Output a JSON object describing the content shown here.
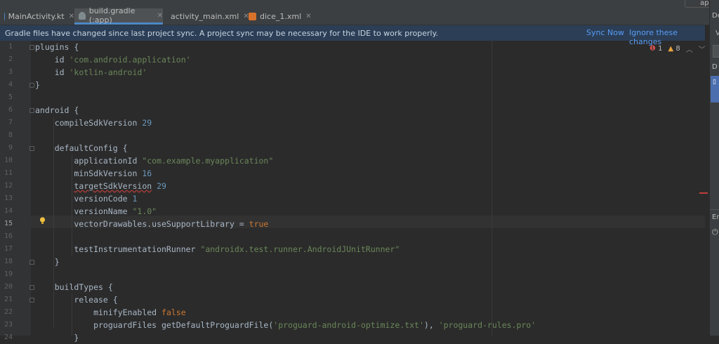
{
  "tabs": [
    {
      "label": "MainActivity.kt",
      "icon": "kotlin-file-icon",
      "active": false
    },
    {
      "label": "build.gradle (:app)",
      "icon": "gradle-elephant-icon",
      "active": true
    },
    {
      "label": "activity_main.xml",
      "icon": "layout-xml-icon",
      "active": false
    },
    {
      "label": "dice_1.xml",
      "icon": "drawable-xml-icon",
      "active": false
    }
  ],
  "toolbar": {
    "run_config": "app"
  },
  "banner": {
    "message": "Gradle files have changed since last project sync. A project sync may be necessary for the IDE to work properly.",
    "sync_now": "Sync Now",
    "ignore": "Ignore these changes"
  },
  "inspections": {
    "errors": "1",
    "warnings": "8"
  },
  "right_panel": {
    "top_label": "De",
    "sub_label": "V",
    "d_label": "D",
    "en_label": "En"
  },
  "colors": {
    "keyword": "#cc7832",
    "string": "#6a8759",
    "number": "#6897bb",
    "banner_bg": "#2b3e56",
    "link": "#589df6"
  },
  "editor": {
    "current_line": 15,
    "lines": [
      {
        "n": "1",
        "code": "plugins {"
      },
      {
        "n": "2",
        "code": "    id 'com.android.application'"
      },
      {
        "n": "3",
        "code": "    id 'kotlin-android'"
      },
      {
        "n": "4",
        "code": "}"
      },
      {
        "n": "5",
        "code": ""
      },
      {
        "n": "6",
        "code": "android {"
      },
      {
        "n": "7",
        "code": "    compileSdkVersion 29"
      },
      {
        "n": "8",
        "code": ""
      },
      {
        "n": "9",
        "code": "    defaultConfig {"
      },
      {
        "n": "10",
        "code": "        applicationId \"com.example.myapplication\""
      },
      {
        "n": "11",
        "code": "        minSdkVersion 16"
      },
      {
        "n": "12",
        "code": "        targetSdkVersion 29"
      },
      {
        "n": "13",
        "code": "        versionCode 1"
      },
      {
        "n": "14",
        "code": "        versionName \"1.0\""
      },
      {
        "n": "15",
        "code": "        vectorDrawables.useSupportLibrary = true"
      },
      {
        "n": "16",
        "code": ""
      },
      {
        "n": "17",
        "code": "        testInstrumentationRunner \"androidx.test.runner.AndroidJUnitRunner\""
      },
      {
        "n": "18",
        "code": "    }"
      },
      {
        "n": "19",
        "code": ""
      },
      {
        "n": "20",
        "code": "    buildTypes {"
      },
      {
        "n": "21",
        "code": "        release {"
      },
      {
        "n": "22",
        "code": "            minifyEnabled false"
      },
      {
        "n": "23",
        "code": "            proguardFiles getDefaultProguardFile('proguard-android-optimize.txt'), 'proguard-rules.pro'"
      },
      {
        "n": "24",
        "code": "        }"
      }
    ]
  }
}
